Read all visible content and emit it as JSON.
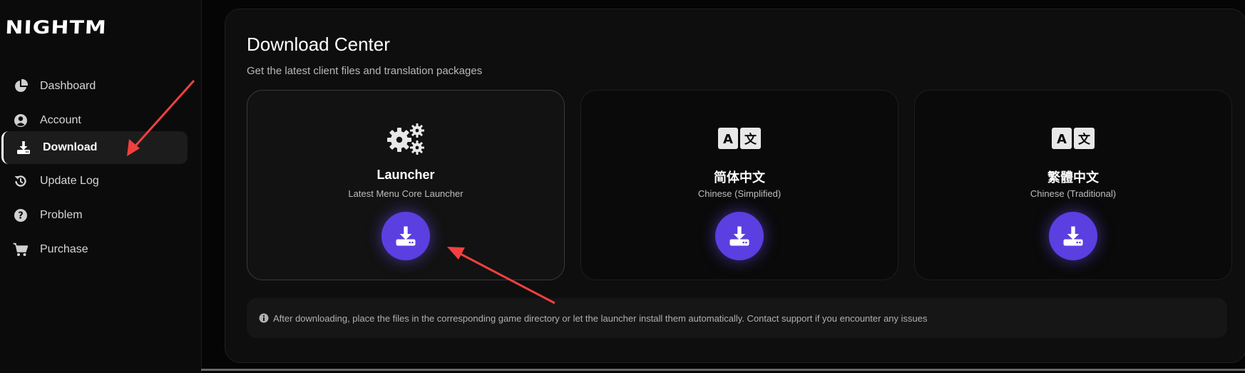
{
  "brand": {
    "logo_text": "NIGHTM"
  },
  "sidebar": {
    "items": [
      {
        "label": "Dashboard",
        "icon": "pie-chart-icon",
        "active": false
      },
      {
        "label": "Account",
        "icon": "user-circle-icon",
        "active": false
      },
      {
        "label": "Download",
        "icon": "download-tray-icon",
        "active": true
      },
      {
        "label": "Update Log",
        "icon": "history-icon",
        "active": false
      },
      {
        "label": "Problem",
        "icon": "question-circle-icon",
        "active": false
      },
      {
        "label": "Purchase",
        "icon": "cart-icon",
        "active": false
      }
    ]
  },
  "main": {
    "title": "Download Center",
    "subtitle": "Get the latest client files and translation packages",
    "cards": [
      {
        "title": "Launcher",
        "subtitle": "Latest Menu Core Launcher",
        "icon": "gears-icon",
        "highlighted": true
      },
      {
        "title": "简体中文",
        "subtitle": "Chinese (Simplified)",
        "icon": "translate-icon",
        "highlighted": false
      },
      {
        "title": "繁體中文",
        "subtitle": "Chinese (Traditional)",
        "icon": "translate-icon",
        "highlighted": false
      }
    ],
    "note": "After downloading, place the files in the corresponding game directory or let the launcher install them automatically. Contact support if you encounter any issues"
  },
  "colors": {
    "accent": "#5b3fe0",
    "annotation_arrow": "#f04040",
    "background": "#050505"
  }
}
